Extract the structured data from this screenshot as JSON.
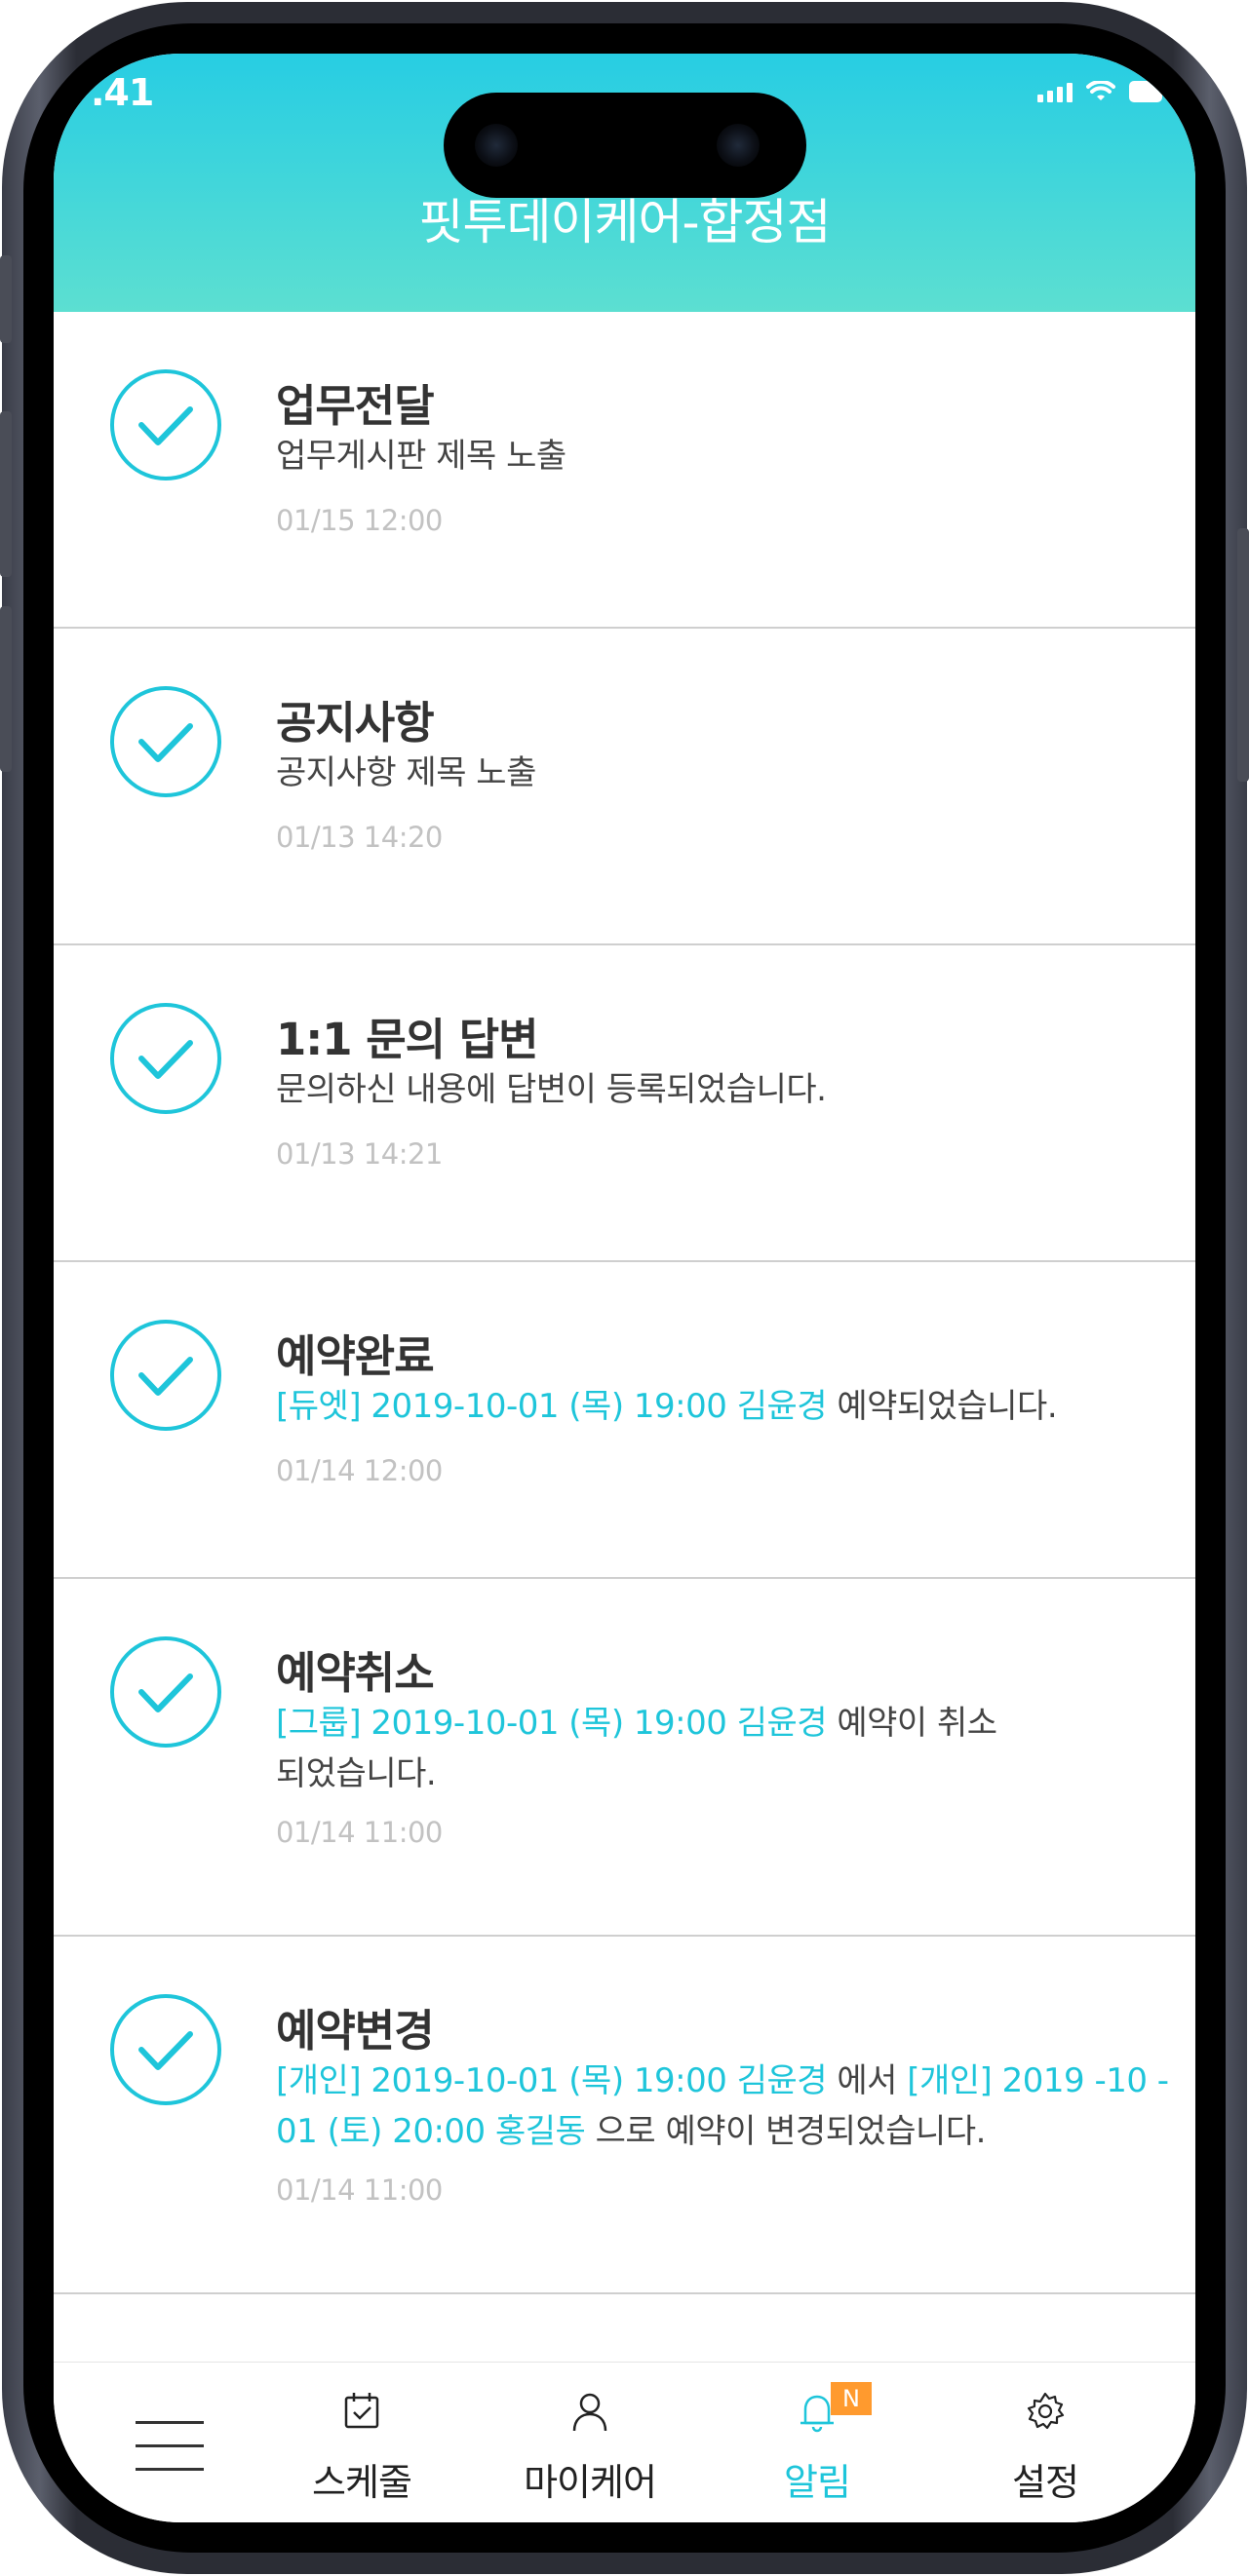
{
  "status_bar": {
    "time": ".41"
  },
  "header": {
    "title": "핏투데이케어-합정점"
  },
  "notifications": [
    {
      "title": "업무전달",
      "body_plain": "업무게시판 제목 노출",
      "time": "01/15 12:00"
    },
    {
      "title": "공지사항",
      "body_plain": "공지사항 제목 노출",
      "time": "01/13 14:20"
    },
    {
      "title": "1:1 문의 답변",
      "body_plain": "문의하신 내용에 답변이 등록되었습니다.",
      "time": "01/13 14:21"
    },
    {
      "title": "예약완료",
      "body_hl": "[듀엣] 2019-10-01 (목) 19:00 김윤경",
      "body_rest": " 예약되었습니다.",
      "time": "01/14 12:00"
    },
    {
      "title": "예약취소",
      "body_hl": "[그룹] 2019-10-01 (목) 19:00 김윤경",
      "body_rest": " 예약이 취소",
      "body_line2": "되었습니다.",
      "time": "01/14 11:00"
    },
    {
      "title": "예약변경",
      "body_hl1": "[개인] 2019-10-01 (목) 19:00 김윤경",
      "body_mid": " 에서 ",
      "body_hl2a": "[개인] 2019 -10 -",
      "body_hl2b": "01 (토) 20:00 홍길동",
      "body_rest": " 으로 예약이 변경되었습니다.",
      "time": "01/14 11:00"
    }
  ],
  "tabbar": {
    "schedule": "스케줄",
    "mycare": "마이케어",
    "alarm": "알림",
    "alarm_badge": "N",
    "settings": "설정"
  },
  "colors": {
    "accent": "#1ec5da",
    "header_top": "#27cde3",
    "header_bottom": "#5cdfd1",
    "badge": "#ff9a2e"
  },
  "icons": [
    "check-circle-icon",
    "menu-icon",
    "calendar-check-icon",
    "person-icon",
    "bell-icon",
    "gear-icon"
  ]
}
